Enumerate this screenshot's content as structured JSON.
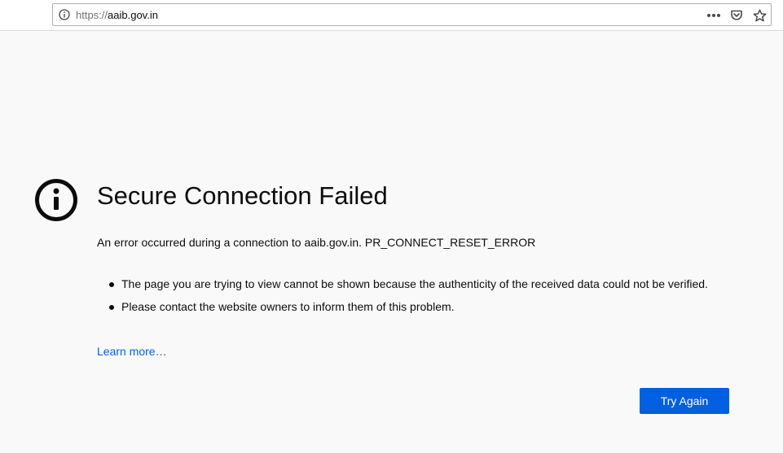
{
  "browser": {
    "url_scheme": "https://",
    "url_host": "aaib.gov.in",
    "icons": {
      "site_info": "info-icon",
      "page_actions": "more-horizontal-icon",
      "pocket": "pocket-icon",
      "bookmark": "star-icon"
    }
  },
  "error": {
    "icon": "info-circle-icon",
    "title": "Secure Connection Failed",
    "short_desc": "An error occurred during a connection to aaib.gov.in. PR_CONNECT_RESET_ERROR",
    "bullets": [
      "The page you are trying to view cannot be shown because the authenticity of the received data could not be verified.",
      "Please contact the website owners to inform them of this problem."
    ],
    "learn_more": "Learn more…",
    "try_again": "Try Again"
  },
  "colors": {
    "background": "#f9f9fa",
    "primary_button": "#0060df",
    "link": "#0060df",
    "text": "#0c0c0d"
  }
}
